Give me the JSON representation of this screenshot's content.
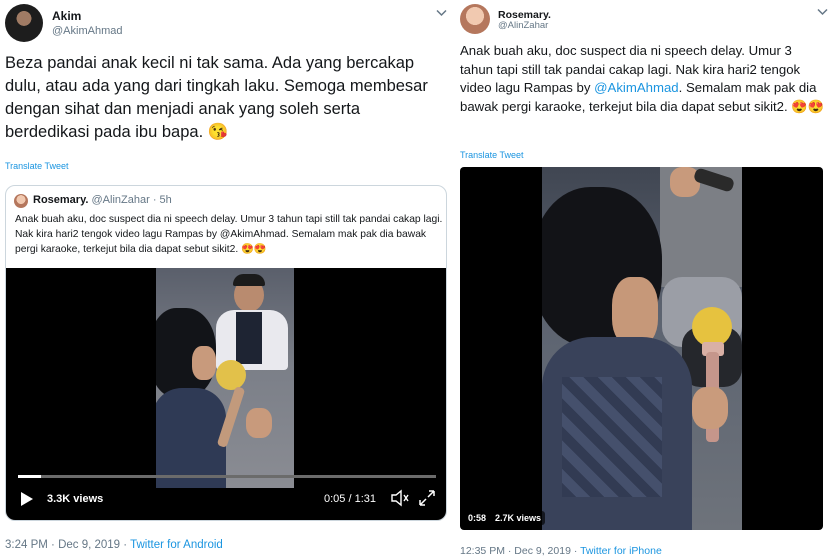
{
  "left_tweet": {
    "name": "Akim",
    "handle": "@AkimAhmad",
    "text": "Beza pandai anak kecil ni tak sama. Ada yang bercakap dulu, atau ada yang dari tingkah laku. Semoga membesar dengan sihat dan menjadi anak yang soleh serta berdedikasi pada ibu bapa. 😘",
    "translate": "Translate Tweet",
    "quote": {
      "name": "Rosemary.",
      "handle": "@AlinZahar",
      "age": "5h",
      "text": "Anak buah aku, doc suspect dia ni speech delay. Umur 3 tahun tapi still tak pandai cakap lagi. Nak kira hari2 tengok video lagu Rampas by @AkimAhmad. Semalam mak pak dia bawak pergi karaoke, terkejut bila dia dapat sebut sikit2. 😍😍"
    },
    "video": {
      "views": "3.3K views",
      "time": "0:05 / 1:31",
      "progress": 0.055
    },
    "footer": {
      "time": "3:24 PM",
      "date": "Dec 9, 2019",
      "source": "Twitter for Android"
    }
  },
  "right_tweet": {
    "name": "Rosemary.",
    "handle": "@AlinZahar",
    "text_before": "Anak buah aku, doc suspect dia ni speech delay. Umur 3 tahun tapi still tak pandai cakap lagi. Nak kira hari2 tengok video lagu Rampas by ",
    "mention": "@AkimAhmad",
    "text_after": ". Semalam mak pak dia bawak pergi karaoke, terkejut bila dia dapat sebut sikit2. 😍😍",
    "translate": "Translate Tweet",
    "video": {
      "time": "0:58",
      "views": "2.7K views"
    },
    "footer": {
      "time": "12:35 PM",
      "date": "Dec 9, 2019",
      "source": "Twitter for iPhone"
    }
  },
  "icons": [
    "chevron-down-icon",
    "play-icon",
    "volume-icon",
    "fullscreen-icon"
  ],
  "colors": {
    "link": "#1b95e0",
    "muted": "#657786",
    "border": "#ccd6dd"
  }
}
